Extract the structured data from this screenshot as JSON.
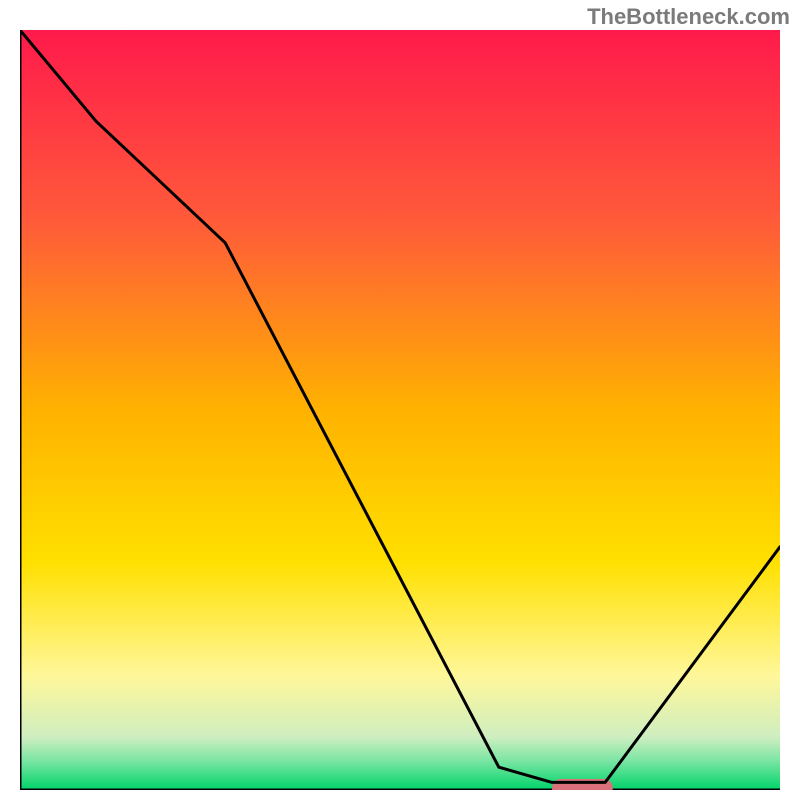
{
  "watermark": "TheBottleneck.com",
  "chart_data": {
    "type": "line",
    "title": "",
    "xlabel": "",
    "ylabel": "",
    "xlim": [
      0,
      100
    ],
    "ylim": [
      0,
      100
    ],
    "series": [
      {
        "name": "bottleneck-curve",
        "x": [
          0,
          10,
          27,
          63,
          70,
          77,
          100
        ],
        "values": [
          100,
          88,
          72,
          3,
          1,
          1,
          32
        ]
      }
    ],
    "optimum_marker": {
      "x": 74,
      "width": 8
    },
    "gradient_stops": [
      {
        "pos": 0.0,
        "color": "#ff1a4b"
      },
      {
        "pos": 0.25,
        "color": "#ff5a3a"
      },
      {
        "pos": 0.5,
        "color": "#ffb200"
      },
      {
        "pos": 0.7,
        "color": "#ffe000"
      },
      {
        "pos": 0.85,
        "color": "#fff79a"
      },
      {
        "pos": 0.93,
        "color": "#cfeec0"
      },
      {
        "pos": 0.96,
        "color": "#7fe6a5"
      },
      {
        "pos": 1.0,
        "color": "#00d46a"
      }
    ],
    "colors": {
      "curve": "#000000",
      "axis": "#000000",
      "marker": "#d9707a"
    }
  }
}
